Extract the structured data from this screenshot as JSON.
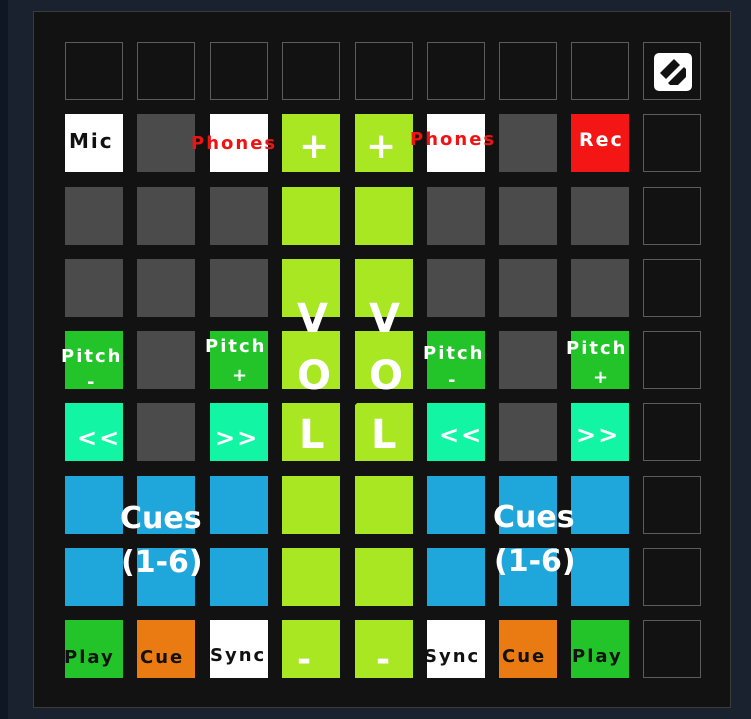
{
  "controller": {
    "top_row": [
      "",
      "",
      "",
      "",
      "",
      "",
      "",
      ""
    ],
    "logo": "novation-logo-icon",
    "row1": {
      "mic": "Mic",
      "phones_left": "Phones",
      "vol_plus_left": "+",
      "vol_plus_right": "+",
      "phones_right": "Phones",
      "rec": "Rec"
    },
    "pitch": {
      "deck1_minus": [
        "Pitch",
        "-"
      ],
      "deck1_plus": [
        "Pitch",
        "+"
      ],
      "deck2_minus": [
        "Pitch",
        "-"
      ],
      "deck2_plus": [
        "Pitch",
        "+"
      ]
    },
    "volume_label_left": [
      "V",
      "O",
      "L"
    ],
    "volume_label_right": [
      "V",
      "O",
      "L"
    ],
    "seek": {
      "deck1_back": "<<",
      "deck1_fwd": ">>",
      "deck2_back": "<<",
      "deck2_fwd": ">>"
    },
    "cues_left": [
      "Cues",
      "(1-6)"
    ],
    "cues_right": [
      "Cues",
      "(1-6)"
    ],
    "bottom": {
      "play_left": "Play",
      "cue_left": "Cue",
      "sync_left": "Sync",
      "vol_minus_left": "-",
      "vol_minus_right": "-",
      "sync_right": "Sync",
      "cue_right": "Cue",
      "play_right": "Play"
    },
    "colors": {
      "gray": "#4b4b4b",
      "lime": "#a9e723",
      "green": "#22c42a",
      "mint": "#12f5a5",
      "blue": "#1fa6da",
      "orange": "#ea7a12",
      "red": "#f41515",
      "white": "#ffffff"
    }
  }
}
